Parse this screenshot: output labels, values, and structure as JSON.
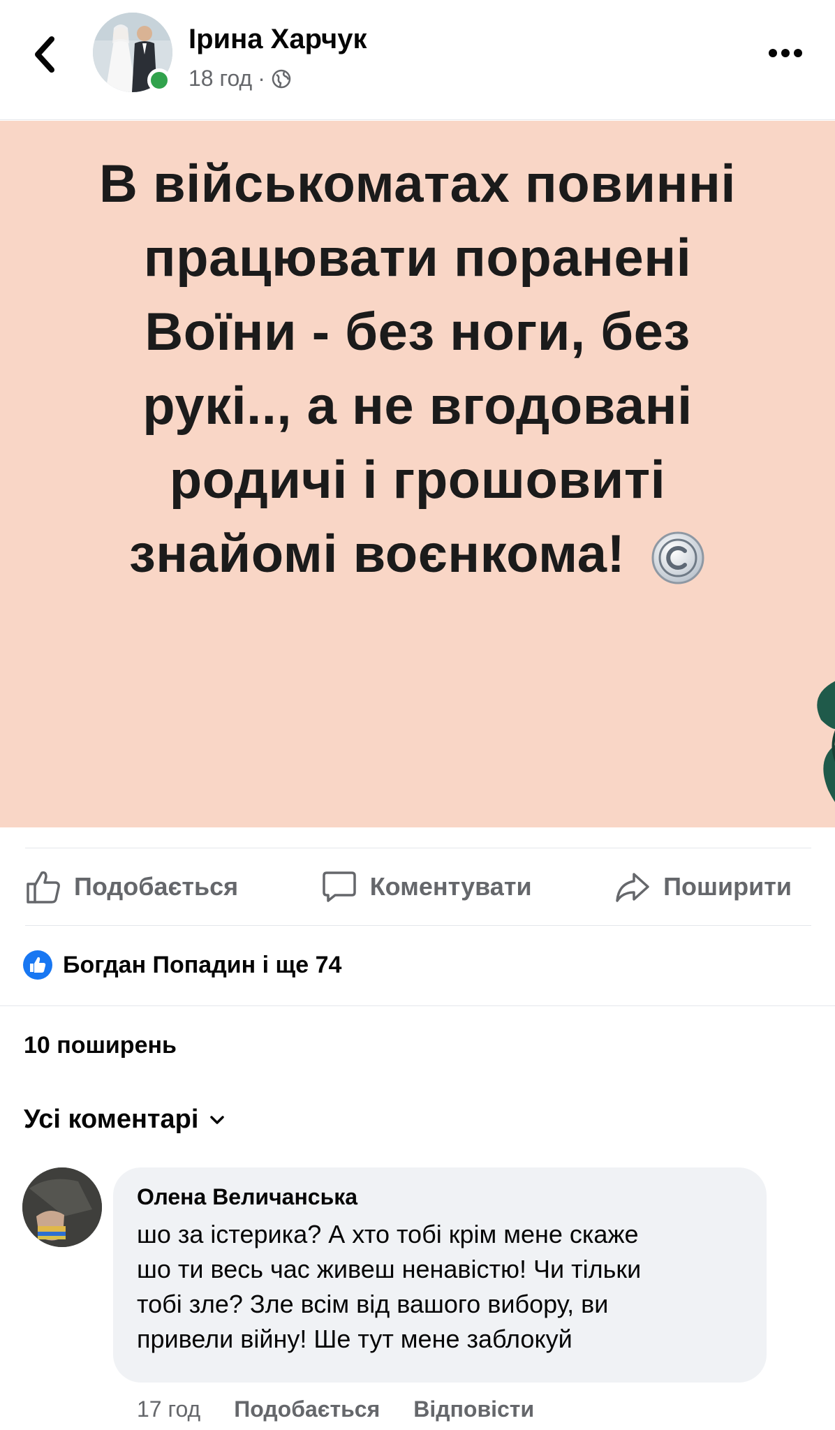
{
  "header": {
    "author_name": "Ірина Харчук",
    "post_time": "18 год",
    "meta_separator": "·"
  },
  "post": {
    "image_text_lines": [
      "В військоматах повинні",
      "працювати поранені",
      "Воїни - без ноги, без",
      "рукі.., а не вгодовані",
      "родичі і грошовиті",
      "знайомі воєнкома!"
    ],
    "image_background": "#f9d6c6"
  },
  "actions": {
    "like_label": "Подобається",
    "comment_label": "Коментувати",
    "share_label": "Поширити"
  },
  "reactions": {
    "summary": "Богдан Попадин і ще 74"
  },
  "shares": {
    "text": "10 поширень"
  },
  "comments_filter": {
    "label": "Усі коментарі"
  },
  "comment": {
    "author": "Олена Величанська",
    "text_lines": [
      "шо за істерика? А хто тобі крім мене скаже",
      "шо ти весь час живеш ненавістю! Чи тільки",
      "тобі зле? Зле всім від вашого вибору, ви",
      "привели війну! Ше тут мене заблокуй"
    ],
    "time": "17 год",
    "like_label": "Подобається",
    "reply_label": "Відповісти"
  },
  "colors": {
    "accent_blue": "#1877f2",
    "online_green": "#31a24c",
    "secondary_text": "#65676b",
    "bubble_bg": "#f0f2f5"
  }
}
